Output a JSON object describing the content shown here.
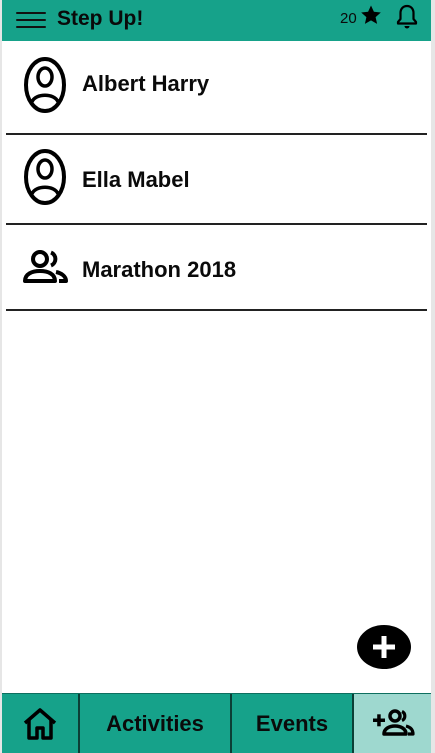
{
  "header": {
    "title": "Step Up!",
    "points": "20",
    "menu_icon": "hamburger-menu-icon",
    "star_icon": "star-icon",
    "bell_icon": "bell-icon"
  },
  "list": [
    {
      "name": "Albert Harry",
      "icon": "person-icon"
    },
    {
      "name": "Ella Mabel",
      "icon": "person-icon"
    },
    {
      "name": "Marathon 2018",
      "icon": "group-icon"
    }
  ],
  "fab": {
    "icon": "plus-icon"
  },
  "nav": {
    "home_icon": "home-icon",
    "activities": "Activities",
    "events": "Events",
    "groups_icon": "add-group-icon"
  },
  "colors": {
    "accent": "#16a28a",
    "active_tab": "#9ed8cf",
    "text": "#0a0a0a"
  }
}
